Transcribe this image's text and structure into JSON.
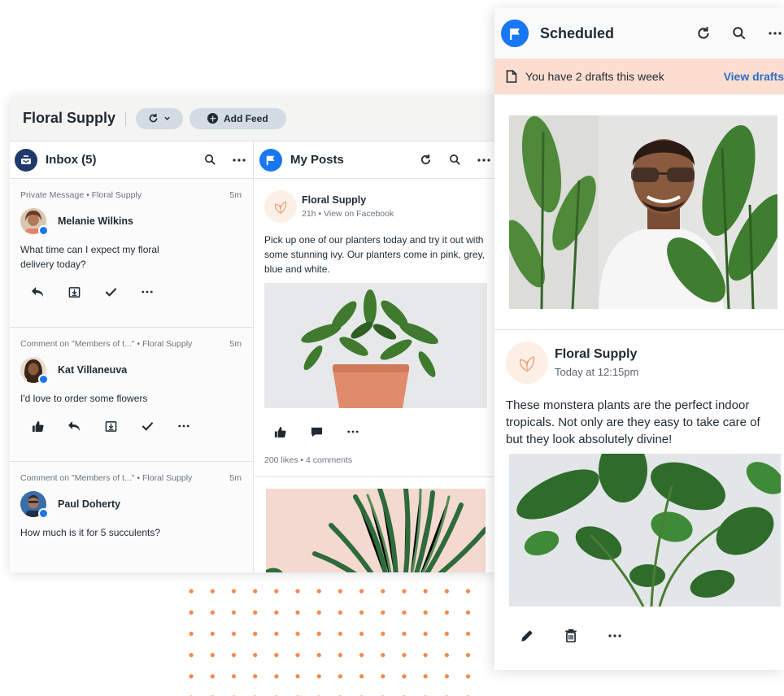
{
  "dashboard": {
    "brand": "Floral Supply",
    "add_feed_label": "Add Feed"
  },
  "inbox": {
    "title": "Inbox (5)",
    "items": [
      {
        "meta": "Private Message  •  Floral Supply",
        "time": "5m",
        "name": "Melanie Wilkins",
        "message": "What time can I expect my floral delivery today?"
      },
      {
        "meta": "Comment on \"Members of t...\"  •  Floral Supply",
        "time": "5m",
        "name": "Kat Villaneuva",
        "message": "I'd love to order some flowers"
      },
      {
        "meta": "Comment on \"Members of t...\"  •  Floral Supply",
        "time": "5m",
        "name": "Paul Doherty",
        "message": "How much is it for 5 succulents?"
      }
    ]
  },
  "posts": {
    "title": "My Posts",
    "post1": {
      "author": "Floral Supply",
      "time": "21h",
      "source": "View on Facebook",
      "text": "Pick up one of our planters today and try it out with some stunning ivy. Our planters come in pink, grey, blue and white.",
      "likes": "200 likes",
      "comments": "4 comments"
    }
  },
  "scheduled": {
    "title": "Scheduled",
    "drafts_text": "You have 2 drafts this week",
    "drafts_link": "View drafts",
    "post": {
      "author": "Floral Supply",
      "time": "Today at 12:15pm",
      "text": "These monstera plants are the perfect indoor tropicals. Not only are they easy to take care of but they look absolutely divine!"
    }
  },
  "colors": {
    "accent_blue": "#1877f2",
    "drafts_bg": "#fbded0",
    "link_blue": "#2e6ec4",
    "dot_orange": "#f28a4b"
  }
}
